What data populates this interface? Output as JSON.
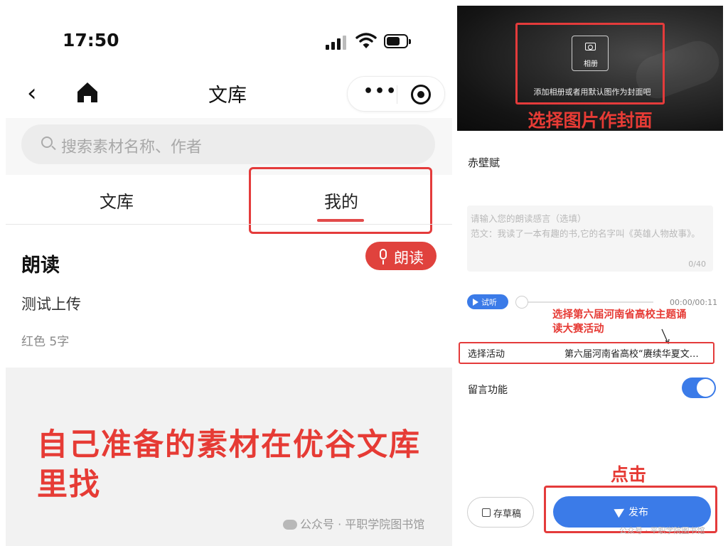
{
  "left": {
    "status_time": "17:50",
    "nav_title": "文库",
    "capsule_more": "•••",
    "search_placeholder": "搜索素材名称、作者",
    "tabs": [
      "文库",
      "我的"
    ],
    "section_title": "朗读",
    "read_button": "朗读",
    "item": {
      "title": "测试上传",
      "meta": "红色   5字"
    },
    "annotation_text": "自己准备的素材在优谷文库里找",
    "watermark": "公众号 · 平职学院图书馆"
  },
  "right": {
    "cover_album_label": "相册",
    "cover_hint": "添加相册或者用默认图作为封面吧",
    "cover_annotation": "选择图片作封面",
    "title": "赤壁赋",
    "textarea_placeholder_line1": "请输入您的朗读感言（选填）",
    "textarea_placeholder_line2": "范文：我读了一本有趣的书,它的名字叫《英雄人物故事》。",
    "textarea_count": "0/40",
    "listen_label": "试听",
    "audio_time": "00:00/00:11",
    "activity_annotation": "选择第六届河南省高校主题诵读大赛活动",
    "activity_label": "选择活动",
    "activity_value": "第六届河南省高校“赓续华夏文…",
    "message_label": "留言功能",
    "message_enabled": true,
    "click_annotation": "点击",
    "draft_label": "存草稿",
    "publish_label": "发布",
    "watermark": "公众号 · 平职学院图书馆"
  },
  "colors": {
    "accent_blue": "#3b7be8",
    "annotation_red": "#e63b35",
    "read_button_red": "#e0423d"
  }
}
